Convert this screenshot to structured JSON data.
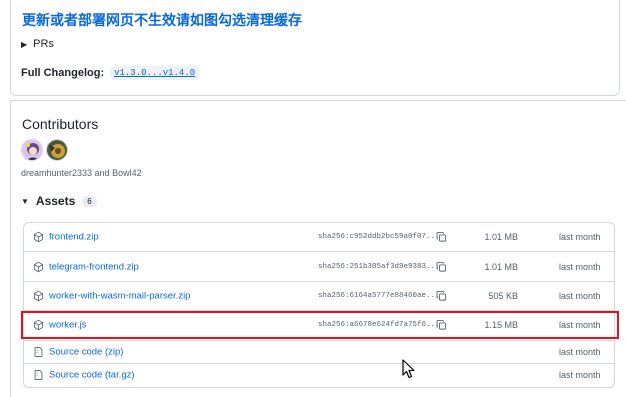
{
  "release": {
    "headline": "更新或者部署网页不生效请如图勾选清理缓存",
    "prs_label": "PRs",
    "changelog_label": "Full Changelog:",
    "changelog_link": "v1.3.0...v1.4.0"
  },
  "contributors": {
    "title": "Contributors",
    "names": "dreamhunter2333 and Bowl42"
  },
  "assets": {
    "title": "Assets",
    "count": "6",
    "items": [
      {
        "name": "frontend.zip",
        "sha": "sha256:c952ddb2bc59a0f07...",
        "size": "1.01 MB",
        "date": "last month"
      },
      {
        "name": "telegram-frontend.zip",
        "sha": "sha256:251b305af3d9e9383...",
        "size": "1.01 MB",
        "date": "last month"
      },
      {
        "name": "worker-with-wasm-mail-parser.zip",
        "sha": "sha256:6164a5777e88460ae...",
        "size": "505 KB",
        "date": "last month"
      },
      {
        "name": "worker.js",
        "sha": "sha256:a6678e624fd7a75f6...",
        "size": "1.15 MB",
        "date": "last month"
      },
      {
        "name": "Source code (zip)",
        "date": "last month"
      },
      {
        "name": "Source code (tar.gz)",
        "date": "last month"
      }
    ]
  },
  "colors": {
    "link": "#0969da",
    "highlight": "#e3131b"
  },
  "icons": {
    "package": "package-icon",
    "file_zip": "file-zip-icon",
    "copy": "copy-icon"
  }
}
